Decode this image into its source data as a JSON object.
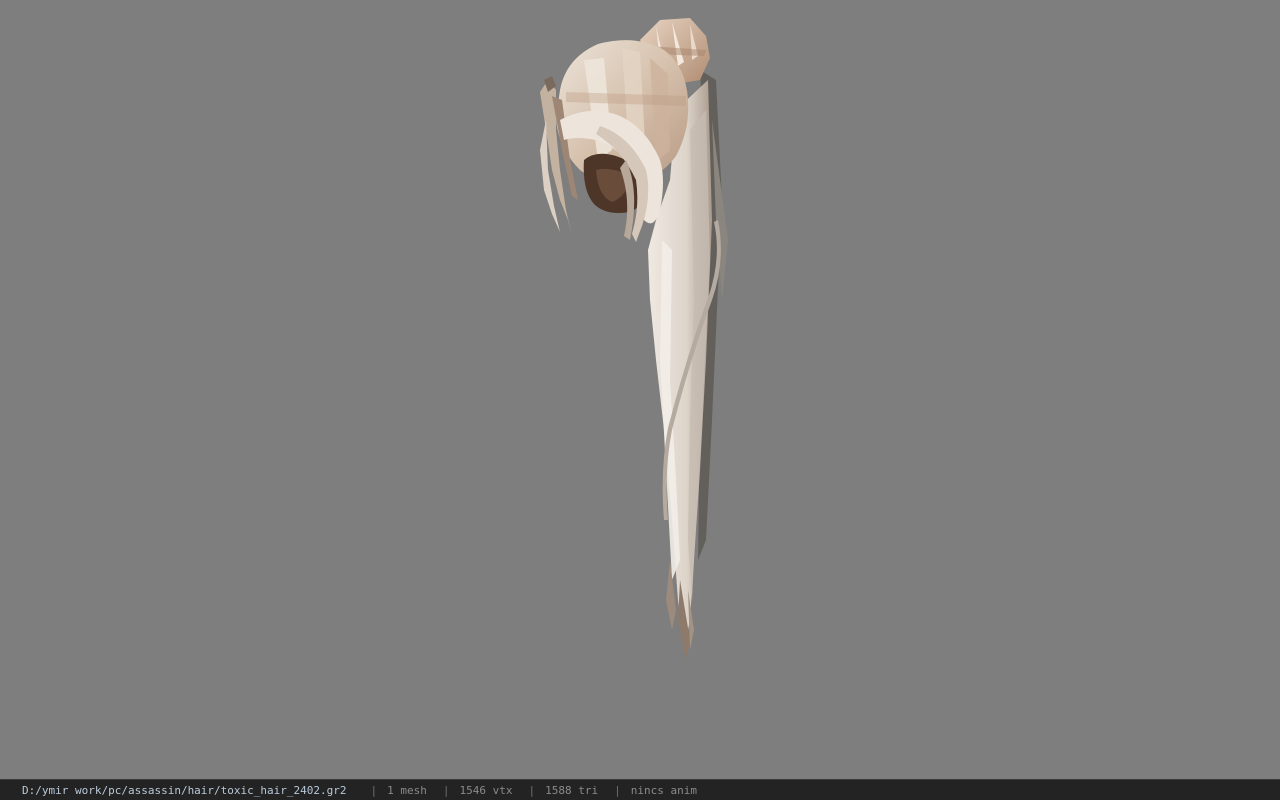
{
  "viewport": {
    "background_color": "#7e7e7e",
    "model_subject": "ponytail-hair-mesh",
    "hair_color_light": "#e6ddd2",
    "hair_color_mid": "#c9b29e",
    "hair_color_dark": "#5c4536"
  },
  "status_bar": {
    "file_path": "D:/ymir work/pc/assassin/hair/toxic_hair_2402.gr2",
    "separator": "|",
    "mesh_count": "1 mesh",
    "vertex_count": "1546 vtx",
    "triangle_count": "1588 tri",
    "animation_status": "nincs anim",
    "path_color": "#b8c8d8",
    "text_color": "#8a8a8a",
    "background_color": "#232323"
  }
}
